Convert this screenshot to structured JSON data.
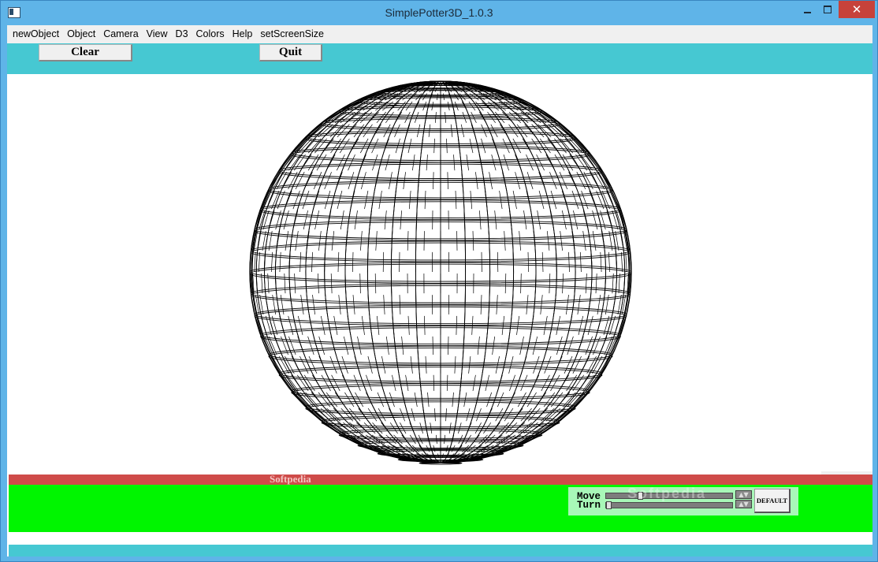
{
  "window": {
    "title": "SimplePotter3D_1.0.3",
    "close_glyph": "✕",
    "icons": [
      "app-icon",
      "minimize-icon",
      "maximize-icon",
      "close-icon"
    ]
  },
  "menu": {
    "items": [
      {
        "label": "newObject"
      },
      {
        "label": "Object"
      },
      {
        "label": "Camera"
      },
      {
        "label": "View"
      },
      {
        "label": "D3"
      },
      {
        "label": "Colors"
      },
      {
        "label": "Help"
      },
      {
        "label": "setScreenSize"
      }
    ]
  },
  "toolbar": {
    "clear_label": "Clear",
    "quit_label": "Quit"
  },
  "canvas": {
    "object": "sphere-wireframe",
    "axis_widget": "axis-gizmo-icon"
  },
  "status": {
    "watermark": "Softpedia"
  },
  "controls": {
    "move_label": "Move",
    "turn_label": "Turn",
    "default_label": "DEFAULT",
    "move_value": 0.0,
    "turn_value": 0.0,
    "spin_glyph": "▲▼"
  },
  "colors": {
    "titlebar": "#5fb4e8",
    "toolbar": "#46c8d2",
    "status_red": "#cf4b49",
    "control_green": "#00f500",
    "control_panel": "#a8f8b8",
    "close_button": "#c7423a"
  }
}
